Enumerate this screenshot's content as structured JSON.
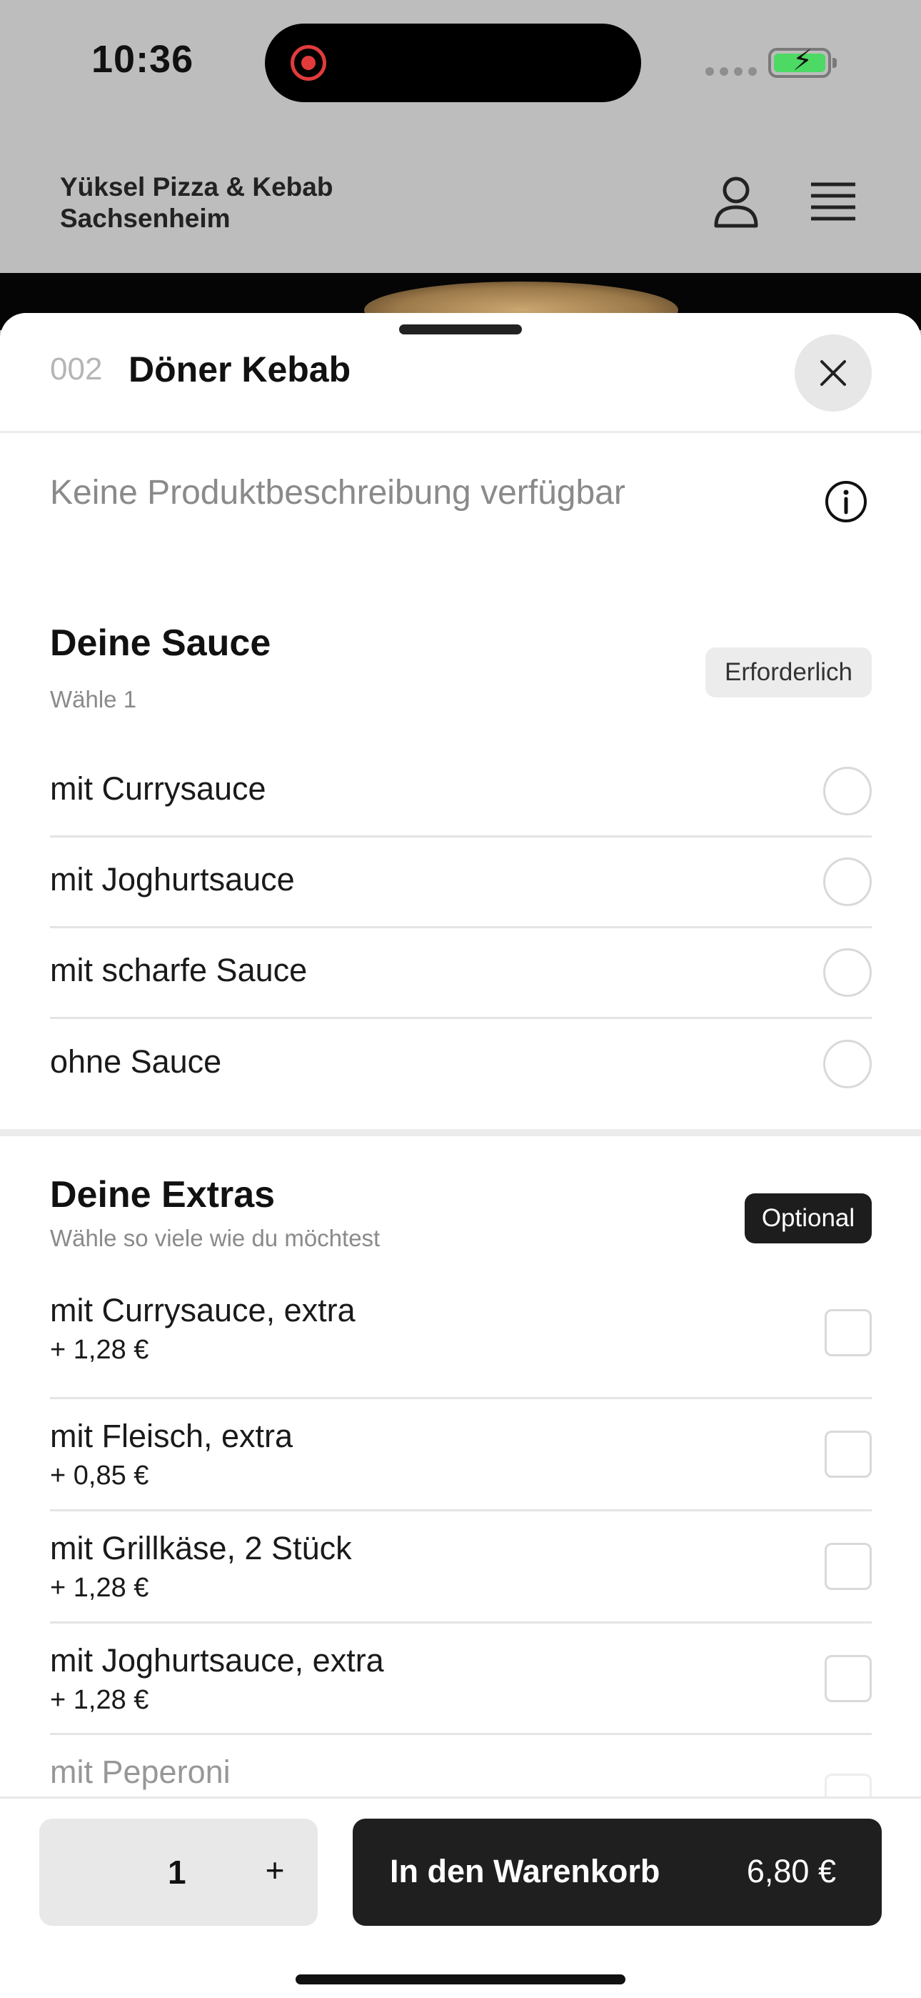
{
  "status_bar": {
    "time": "10:36"
  },
  "header": {
    "store_name_line1": "Yüksel Pizza & Kebab",
    "store_name_line2": "Sachsenheim"
  },
  "product": {
    "number": "002",
    "title": "Döner Kebab",
    "description": "Keine Produktbeschreibung verfügbar"
  },
  "sauce_group": {
    "title": "Deine Sauce",
    "subtitle": "Wähle 1",
    "badge": "Erforderlich",
    "options": [
      {
        "label": "mit Currysauce"
      },
      {
        "label": "mit Joghurtsauce"
      },
      {
        "label": "mit scharfe Sauce"
      },
      {
        "label": "ohne Sauce"
      }
    ]
  },
  "extras_group": {
    "title": "Deine Extras",
    "subtitle": "Wähle so viele wie du möchtest",
    "badge": "Optional",
    "options": [
      {
        "label": "mit Currysauce, extra",
        "price": "+ 1,28 €"
      },
      {
        "label": "mit Fleisch, extra",
        "price": "+ 0,85 €"
      },
      {
        "label": "mit Grillkäse, 2 Stück",
        "price": "+ 1,28 €"
      },
      {
        "label": "mit Joghurtsauce, extra",
        "price": "+ 1,28 €"
      },
      {
        "label": "mit Peperoni",
        "price": ""
      }
    ]
  },
  "bottom_bar": {
    "quantity": "1",
    "plus_label": "+",
    "cart_label": "In den Warenkorb",
    "cart_price": "6,80 €"
  },
  "colors": {
    "accent": "#1f1f1f",
    "badge_optional_bg": "#1d1d1d",
    "battery": "#4cd964",
    "record": "#e23b3b"
  }
}
